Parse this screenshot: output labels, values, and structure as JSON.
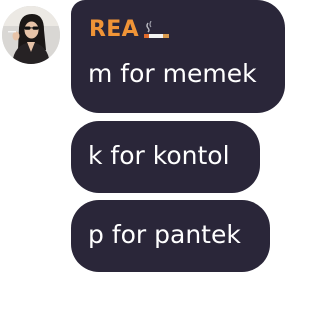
{
  "sender": {
    "name": "REA",
    "badge_icon": "cigarette-icon",
    "name_color": "#f09437"
  },
  "avatar": {
    "icon": "user-avatar"
  },
  "messages": [
    {
      "text": "m for memek"
    },
    {
      "text": "k for kontol"
    },
    {
      "text": "p for pantek"
    }
  ],
  "colors": {
    "bubble": "#2a2639",
    "text": "#ffffff"
  }
}
